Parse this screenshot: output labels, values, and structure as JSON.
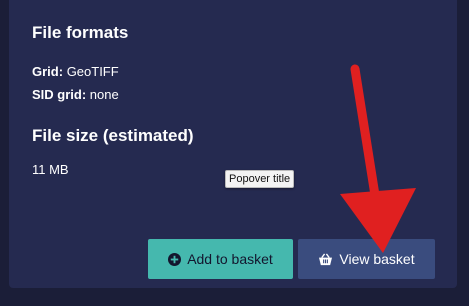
{
  "file_formats": {
    "title": "File formats",
    "grid_label": "Grid:",
    "grid_value": "GeoTIFF",
    "sid_label": "SID grid:",
    "sid_value": "none"
  },
  "file_size": {
    "title": "File size (estimated)",
    "value": "11 MB"
  },
  "popover": {
    "text": "Popover title"
  },
  "buttons": {
    "add_label": "Add to basket",
    "view_label": "View basket"
  },
  "colors": {
    "panel": "#252a50",
    "add_button": "#45b8ae",
    "view_button": "#3a4c7e",
    "annotation_arrow": "#e02020"
  },
  "icons": [
    "plus-circle-icon",
    "basket-icon"
  ]
}
